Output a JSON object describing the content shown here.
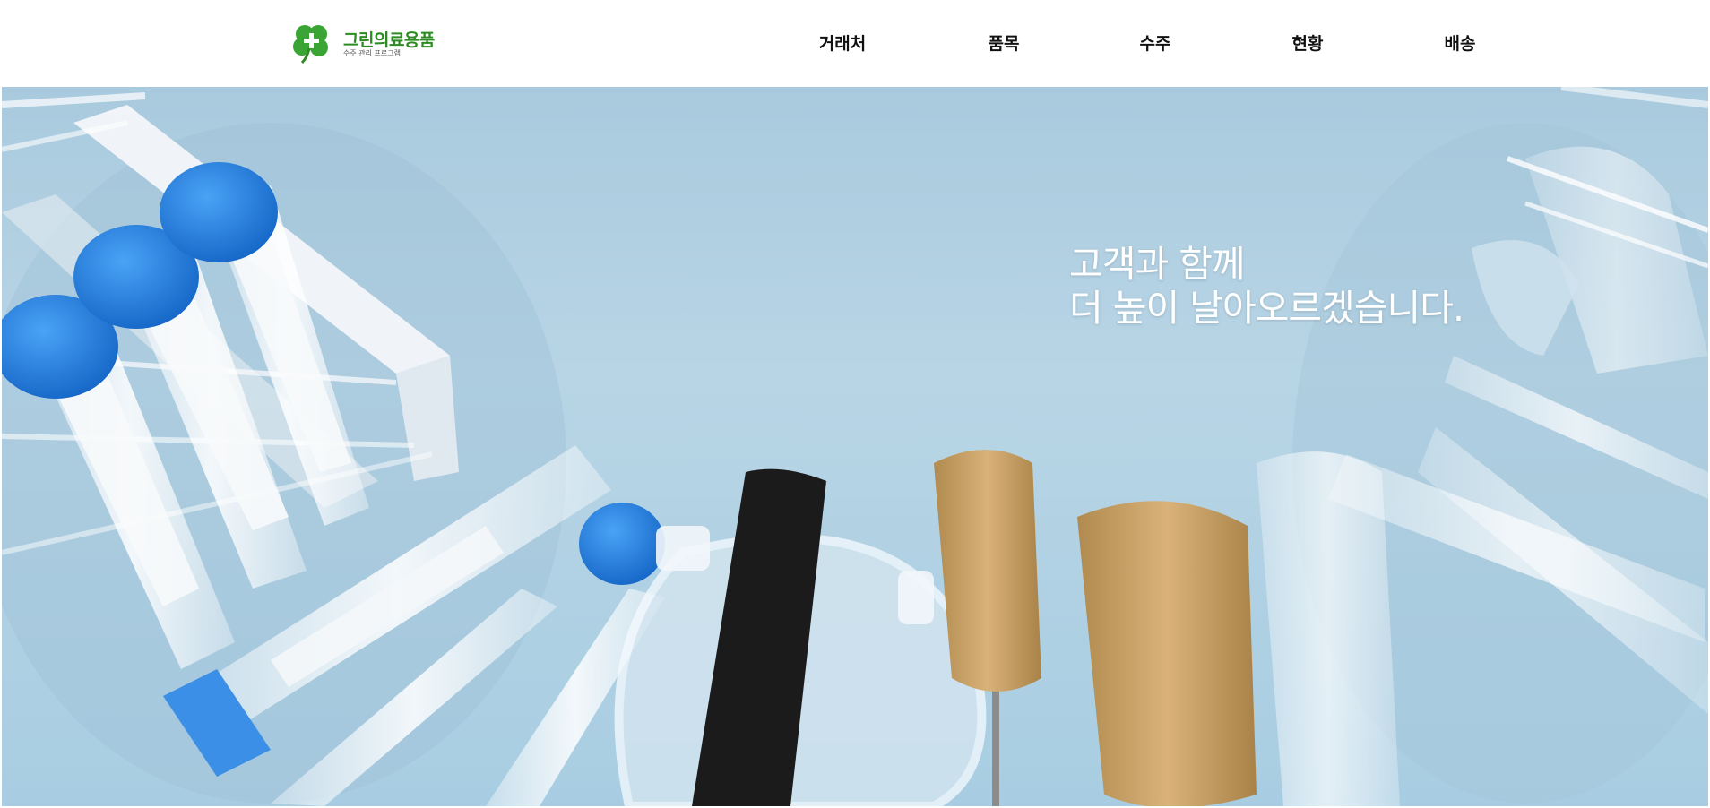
{
  "brand": {
    "name": "그린의료용품",
    "tagline": "수주 관리 프로그램",
    "logo_icon": "clover-cross-icon",
    "color": "#2e8b23"
  },
  "nav": {
    "items": [
      {
        "label": "거래처"
      },
      {
        "label": "품목"
      },
      {
        "label": "수주"
      },
      {
        "label": "현황"
      },
      {
        "label": "배송"
      }
    ]
  },
  "hero": {
    "line1": "고객과 함께",
    "line2": "더 높이 날아오르겠습니다.",
    "image": "laboratory-equipment-photo",
    "background_color": "#b3d3e4"
  }
}
